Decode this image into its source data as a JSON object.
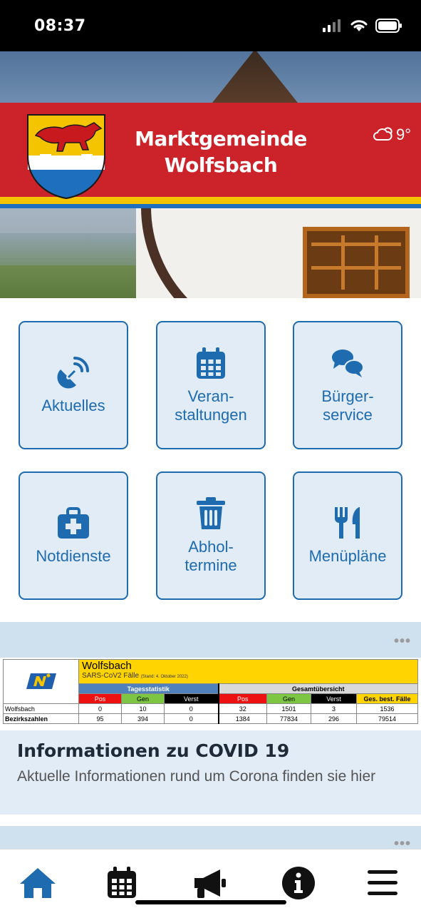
{
  "status_bar": {
    "time": "08:37"
  },
  "header": {
    "title_line1": "Marktgemeinde",
    "title_line2": "Wolfsbach",
    "weather_temp": "9°",
    "weather_icon": "cloud-sun-icon"
  },
  "tiles": [
    {
      "label": "Aktuelles",
      "icon": "satellite-dish-icon"
    },
    {
      "label_line1": "Veran-",
      "label_line2": "staltungen",
      "icon": "calendar-icon"
    },
    {
      "label_line1": "Bürger-",
      "label_line2": "service",
      "icon": "chat-bubbles-icon"
    },
    {
      "label": "Notdienste",
      "icon": "first-aid-kit-icon"
    },
    {
      "label_line1": "Abhol-",
      "label_line2": "termine",
      "icon": "trash-can-icon"
    },
    {
      "label": "Menüpläne",
      "icon": "fork-knife-icon"
    }
  ],
  "covid_table": {
    "region": "Wolfsbach",
    "subtitle": "SARS-CoV2 Fälle",
    "stand": "(Stand: 4. Oktober 2022)",
    "group_daily": "Tagesstatistik",
    "group_total": "Gesamtübersicht",
    "columns": [
      "Pos",
      "Gen",
      "Verst",
      "Pos",
      "Gen",
      "Verst",
      "Ges. best. Fälle"
    ],
    "rows": [
      {
        "label": "Wolfsbach",
        "values": [
          "0",
          "10",
          "0",
          "32",
          "1501",
          "3",
          "1536"
        ]
      },
      {
        "label": "Bezirkszahlen",
        "values": [
          "95",
          "394",
          "0",
          "1384",
          "77834",
          "296",
          "79514"
        ]
      }
    ]
  },
  "news_card": {
    "title": "Informationen zu COVID 19",
    "text": "Aktuelle Informationen rund um Corona finden sie hier"
  },
  "more_label": "•••",
  "tabbar": {
    "items": [
      "home-icon",
      "calendar-icon",
      "megaphone-icon",
      "info-icon",
      "menu-icon"
    ],
    "active_color": "#1e6bb0"
  },
  "colors": {
    "accent": "#1e6bb0",
    "banner_red": "#cc2229",
    "stripe_yellow": "#f5c400"
  }
}
